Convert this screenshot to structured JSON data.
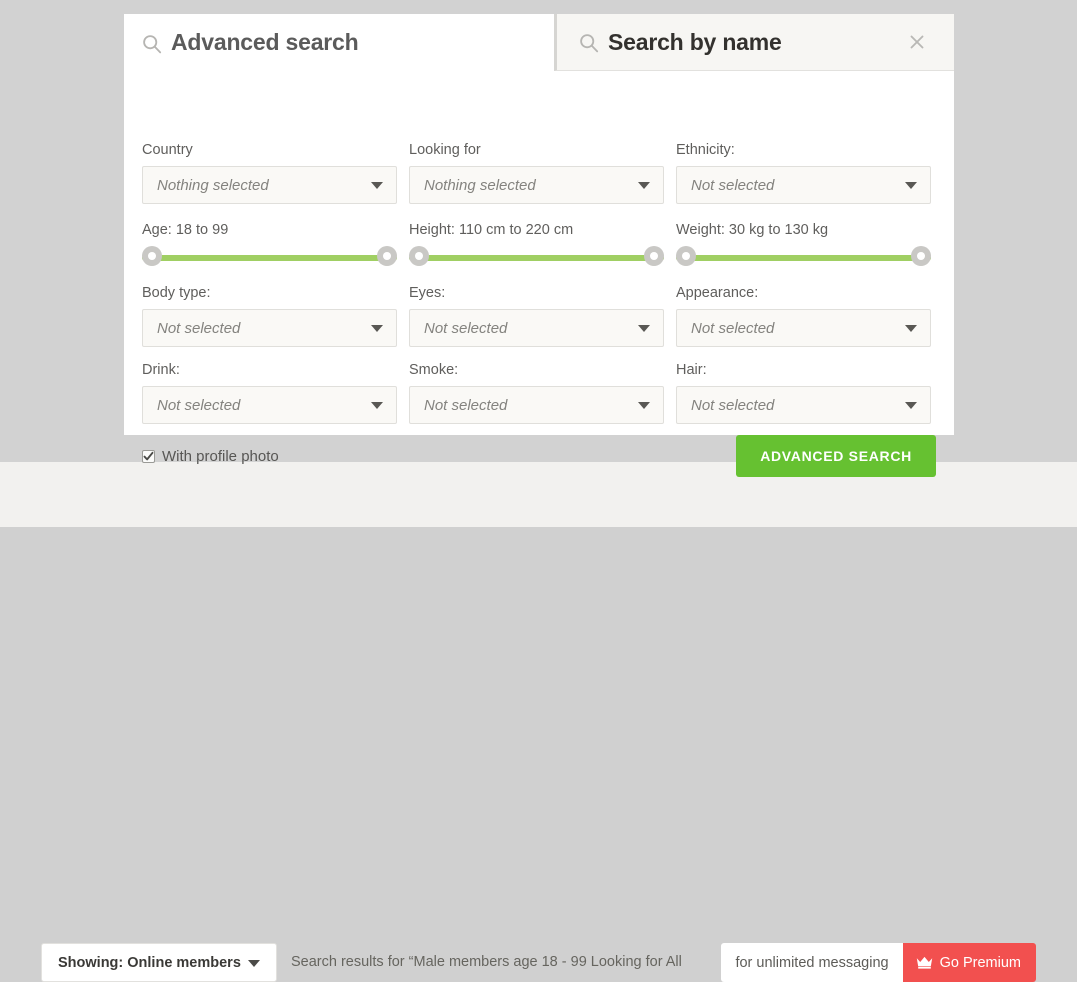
{
  "colors": {
    "accent_green": "#66c131",
    "slider_green": "#a0cf63",
    "premium_red": "#f2504f",
    "page_gray": "#d2d2d2",
    "bottom_bar": "#f2f1ef"
  },
  "tabs": {
    "active": {
      "label": "Advanced search",
      "icon": "search-icon"
    },
    "inactive": {
      "label": "Search by name",
      "icon": "search-icon",
      "close_icon": "close-icon"
    }
  },
  "form": {
    "row1": [
      {
        "label": "Country",
        "value": "Nothing selected",
        "name": "country"
      },
      {
        "label": "Looking for",
        "value": "Nothing selected",
        "name": "looking-for"
      },
      {
        "label": "Ethnicity:",
        "value": "Not selected",
        "name": "ethnicity"
      }
    ],
    "sliders": [
      {
        "label": "Age: 18 to 99",
        "name": "age",
        "min_pct": 0,
        "max_pct": 100
      },
      {
        "label": "Height: 110 cm to 220 cm",
        "name": "height",
        "min_pct": 0,
        "max_pct": 100
      },
      {
        "label": "Weight: 30 kg to 130 kg",
        "name": "weight",
        "min_pct": 0,
        "max_pct": 100
      }
    ],
    "row2": [
      {
        "label": "Body type:",
        "value": "Not selected",
        "name": "body-type"
      },
      {
        "label": "Eyes:",
        "value": "Not selected",
        "name": "eyes"
      },
      {
        "label": "Appearance:",
        "value": "Not selected",
        "name": "appearance"
      }
    ],
    "row3": [
      {
        "label": "Drink:",
        "value": "Not selected",
        "name": "drink"
      },
      {
        "label": "Smoke:",
        "value": "Not selected",
        "name": "smoke"
      },
      {
        "label": "Hair:",
        "value": "Not selected",
        "name": "hair"
      }
    ],
    "checkbox": {
      "label": "With profile photo",
      "checked": true
    },
    "submit_label": "ADVANCED SEARCH"
  },
  "bottom_bar": {
    "showing_label": "Showing: Online members",
    "results_text": "Search results for “Male members age 18 - 99 Looking for All",
    "promo_text": "for unlimited messaging",
    "promo_button_label": "Go Premium",
    "promo_icon": "crown-icon"
  }
}
